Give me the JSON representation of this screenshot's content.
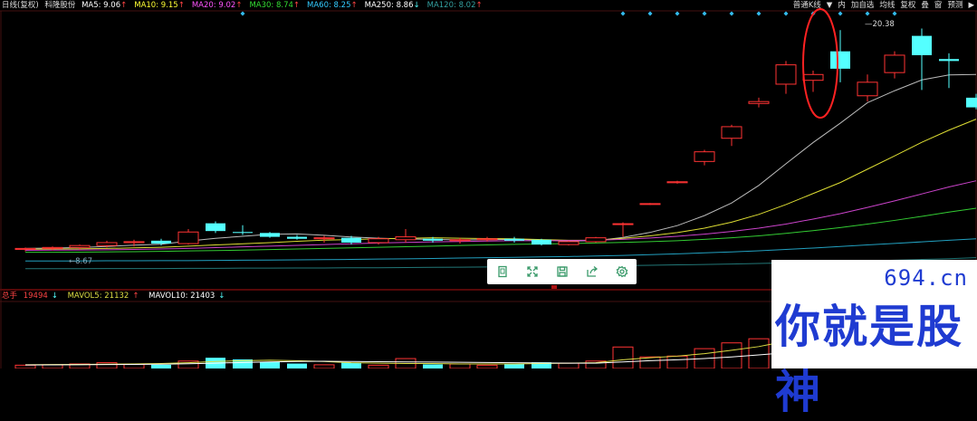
{
  "legend": {
    "title": "日线(复权)",
    "stock": "科隆股份",
    "ma": [
      {
        "label": "MA5: 9.06",
        "arrow": "↑",
        "color": "#ffffff"
      },
      {
        "label": "MA10: 9.15",
        "arrow": "↑",
        "color": "#ffff33"
      },
      {
        "label": "MA20: 9.02",
        "arrow": "↑",
        "color": "#ff55ff"
      },
      {
        "label": "MA30: 8.74",
        "arrow": "↑",
        "color": "#33dd33"
      },
      {
        "label": "MA60: 8.25",
        "arrow": "↑",
        "color": "#33ccff"
      },
      {
        "label": "MA250: 8.86",
        "arrow": "↓",
        "color": "#ffffff"
      },
      {
        "label": "MA120: 8.02",
        "arrow": "↑",
        "color": "#33a0a0"
      }
    ]
  },
  "toolbar": {
    "items": [
      "普通K线",
      "▼",
      "内",
      "加自选",
      "均线",
      "复权",
      "叠",
      "窗",
      "预测",
      "▶"
    ]
  },
  "volume_legend": {
    "label": "总手",
    "value": "19494",
    "value_arrow": "↓",
    "mavol5": "MAVOL5: 21132",
    "mavol5_arrow": "↑",
    "mavol10": "MAVOL10: 21403",
    "mavol10_arrow": "↓"
  },
  "annotations": {
    "high": "20.38",
    "low": "8.67"
  },
  "watermark": {
    "site": "694.cn",
    "slogan": "你就是股神"
  },
  "float_toolbar": {
    "icons": [
      "bookmark-icon",
      "fullscreen-icon",
      "save-icon",
      "share-icon",
      "settings-icon"
    ]
  },
  "colors": {
    "up": "#ff3333",
    "down": "#54ffff",
    "ma5": "#bbbbbb",
    "ma10": "#dddd33",
    "ma20": "#cc44cc",
    "ma30": "#33cc33",
    "ma60": "#22a0c0",
    "ma120": "#227777",
    "mavol5": "#dddd44",
    "mavol10": "#ffffff",
    "marker": "#33bbee",
    "highlight": "#ff2222"
  },
  "chart_data": {
    "type": "candlestick",
    "y_range": [
      7.8,
      21.2
    ],
    "candles": [
      {
        "o": 8.95,
        "h": 9.05,
        "l": 8.85,
        "c": 9.0,
        "v": 800
      },
      {
        "o": 9.0,
        "h": 9.1,
        "l": 8.9,
        "c": 9.05,
        "v": 900
      },
      {
        "o": 9.05,
        "h": 9.2,
        "l": 8.95,
        "c": 9.15,
        "v": 1100
      },
      {
        "o": 9.15,
        "h": 9.4,
        "l": 9.05,
        "c": 9.3,
        "v": 1400
      },
      {
        "o": 9.3,
        "h": 9.45,
        "l": 9.1,
        "c": 9.35,
        "v": 1000
      },
      {
        "o": 9.4,
        "h": 9.5,
        "l": 9.15,
        "c": 9.25,
        "v": 900
      },
      {
        "o": 9.25,
        "h": 10.0,
        "l": 9.2,
        "c": 9.85,
        "v": 1800
      },
      {
        "o": 10.3,
        "h": 10.4,
        "l": 9.8,
        "c": 9.9,
        "v": 2600
      },
      {
        "o": 9.85,
        "h": 10.2,
        "l": 9.7,
        "c": 9.8,
        "v": 2200
      },
      {
        "o": 9.8,
        "h": 9.85,
        "l": 9.55,
        "c": 9.6,
        "v": 1600
      },
      {
        "o": 9.6,
        "h": 9.7,
        "l": 9.45,
        "c": 9.5,
        "v": 1200
      },
      {
        "o": 9.5,
        "h": 9.65,
        "l": 9.3,
        "c": 9.55,
        "v": 900
      },
      {
        "o": 9.55,
        "h": 9.65,
        "l": 9.2,
        "c": 9.3,
        "v": 1400
      },
      {
        "o": 9.3,
        "h": 9.6,
        "l": 9.2,
        "c": 9.5,
        "v": 800
      },
      {
        "o": 9.45,
        "h": 10.0,
        "l": 9.3,
        "c": 9.6,
        "v": 2400
      },
      {
        "o": 9.5,
        "h": 9.6,
        "l": 9.3,
        "c": 9.4,
        "v": 1000
      },
      {
        "o": 9.4,
        "h": 9.55,
        "l": 9.25,
        "c": 9.45,
        "v": 1100
      },
      {
        "o": 9.45,
        "h": 9.6,
        "l": 9.35,
        "c": 9.5,
        "v": 800
      },
      {
        "o": 9.5,
        "h": 9.6,
        "l": 9.3,
        "c": 9.4,
        "v": 1200
      },
      {
        "o": 9.45,
        "h": 9.5,
        "l": 9.15,
        "c": 9.2,
        "v": 1500
      },
      {
        "o": 9.2,
        "h": 9.4,
        "l": 9.15,
        "c": 9.35,
        "v": 1300
      },
      {
        "o": 9.35,
        "h": 9.6,
        "l": 9.3,
        "c": 9.55,
        "v": 1800
      },
      {
        "o": 10.25,
        "h": 10.35,
        "l": 9.6,
        "c": 10.28,
        "v": 5200
      },
      {
        "o": 11.3,
        "h": 11.35,
        "l": 11.25,
        "c": 11.32,
        "v": 2800
      },
      {
        "o": 12.4,
        "h": 12.5,
        "l": 12.35,
        "c": 12.45,
        "v": 3000
      },
      {
        "o": 13.5,
        "h": 14.1,
        "l": 13.3,
        "c": 14.0,
        "v": 4800
      },
      {
        "o": 14.7,
        "h": 15.4,
        "l": 14.3,
        "c": 15.3,
        "v": 6200
      },
      {
        "o": 16.5,
        "h": 16.8,
        "l": 16.3,
        "c": 16.6,
        "v": 7200
      },
      {
        "o": 17.5,
        "h": 18.7,
        "l": 17.0,
        "c": 18.5,
        "v": 12800
      },
      {
        "o": 17.7,
        "h": 18.2,
        "l": 17.1,
        "c": 18.0,
        "v": 10800
      },
      {
        "o": 19.2,
        "h": 20.3,
        "l": 17.6,
        "c": 18.3,
        "v": 13000
      },
      {
        "o": 16.9,
        "h": 18.0,
        "l": 16.6,
        "c": 17.6,
        "v": 9500
      },
      {
        "o": 18.1,
        "h": 19.2,
        "l": 17.8,
        "c": 19.0,
        "v": 11200
      },
      {
        "o": 20.0,
        "h": 20.38,
        "l": 17.2,
        "c": 19.0,
        "v": 12500
      },
      {
        "o": 18.8,
        "h": 19.1,
        "l": 17.3,
        "c": 18.7,
        "v": 8800
      },
      {
        "o": 16.8,
        "h": 17.0,
        "l": 16.2,
        "c": 16.3,
        "v": 6000
      }
    ],
    "ma_lines": {
      "ma5": [
        9.0,
        9.02,
        9.05,
        9.1,
        9.17,
        9.22,
        9.38,
        9.52,
        9.63,
        9.73,
        9.75,
        9.68,
        9.59,
        9.53,
        9.49,
        9.47,
        9.44,
        9.45,
        9.47,
        9.42,
        9.38,
        9.4,
        9.57,
        9.83,
        10.18,
        10.7,
        11.35,
        12.26,
        13.38,
        14.48,
        15.48,
        16.54,
        17.16,
        17.72,
        17.98,
        18.0
      ],
      "ma10": [
        8.96,
        8.97,
        8.98,
        9.0,
        9.03,
        9.06,
        9.12,
        9.18,
        9.24,
        9.3,
        9.37,
        9.43,
        9.46,
        9.5,
        9.52,
        9.55,
        9.53,
        9.51,
        9.5,
        9.46,
        9.42,
        9.42,
        9.52,
        9.65,
        9.82,
        10.05,
        10.36,
        10.76,
        11.27,
        11.84,
        12.41,
        13.1,
        13.79,
        14.49,
        15.12,
        15.69
      ],
      "ma20": [
        8.9,
        8.91,
        8.92,
        8.93,
        8.95,
        8.97,
        9.0,
        9.04,
        9.08,
        9.12,
        9.16,
        9.2,
        9.24,
        9.28,
        9.31,
        9.34,
        9.36,
        9.38,
        9.4,
        9.4,
        9.41,
        9.42,
        9.47,
        9.54,
        9.63,
        9.74,
        9.88,
        10.05,
        10.26,
        10.52,
        10.8,
        11.12,
        11.46,
        11.82,
        12.18,
        12.5
      ],
      "ma30": [
        8.8,
        8.8,
        8.81,
        8.82,
        8.83,
        8.85,
        8.87,
        8.89,
        8.91,
        8.94,
        8.97,
        9.0,
        9.03,
        9.06,
        9.09,
        9.12,
        9.15,
        9.18,
        9.21,
        9.23,
        9.25,
        9.28,
        9.31,
        9.35,
        9.4,
        9.47,
        9.55,
        9.65,
        9.78,
        9.92,
        10.08,
        10.26,
        10.45,
        10.66,
        10.88,
        11.08
      ],
      "ma60": [
        8.35,
        8.35,
        8.35,
        8.36,
        8.36,
        8.37,
        8.37,
        8.38,
        8.39,
        8.4,
        8.41,
        8.42,
        8.43,
        8.45,
        8.46,
        8.48,
        8.5,
        8.52,
        8.54,
        8.56,
        8.58,
        8.61,
        8.64,
        8.68,
        8.72,
        8.77,
        8.82,
        8.88,
        8.95,
        9.02,
        9.1,
        9.18,
        9.26,
        9.34,
        9.42,
        9.5
      ],
      "ma120": [
        7.95,
        7.95,
        7.95,
        7.96,
        7.96,
        7.96,
        7.97,
        7.97,
        7.98,
        7.98,
        7.99,
        7.99,
        8.0,
        8.0,
        8.01,
        8.02,
        8.03,
        8.04,
        8.05,
        8.06,
        8.07,
        8.09,
        8.11,
        8.13,
        8.15,
        8.17,
        8.19,
        8.22,
        8.25,
        8.28,
        8.31,
        8.35,
        8.39,
        8.43,
        8.47,
        8.52
      ]
    },
    "mavol5": [
      900,
      950,
      1000,
      1050,
      1100,
      1200,
      1400,
      1700,
      1900,
      2000,
      1900,
      1700,
      1400,
      1300,
      1200,
      1200,
      1100,
      1100,
      1100,
      1200,
      1300,
      1400,
      2100,
      2600,
      3000,
      3600,
      4400,
      5300,
      6600,
      7900,
      9000,
      10400,
      11100,
      11400,
      10800,
      9600
    ],
    "mavol10": [
      850,
      870,
      900,
      950,
      1000,
      1050,
      1150,
      1300,
      1450,
      1600,
      1700,
      1750,
      1700,
      1650,
      1600,
      1550,
      1500,
      1450,
      1400,
      1350,
      1300,
      1300,
      1600,
      1900,
      2100,
      2400,
      2800,
      3300,
      3800,
      4400,
      5000,
      5700,
      6400,
      7100,
      7700,
      8200
    ]
  }
}
